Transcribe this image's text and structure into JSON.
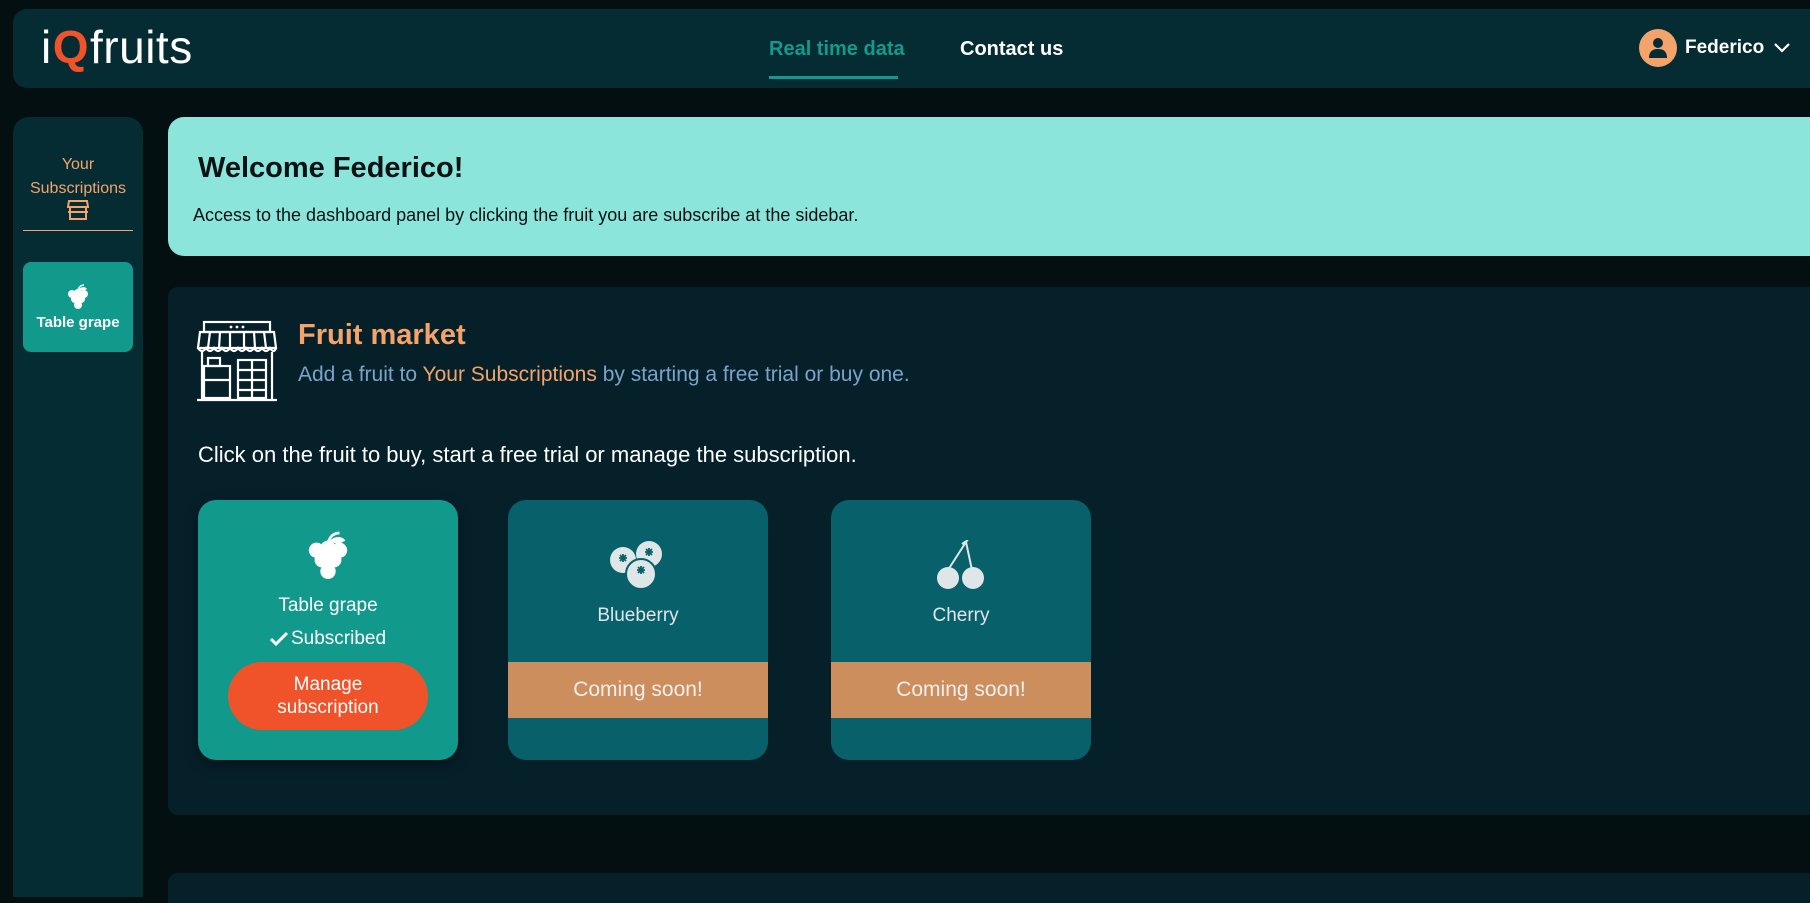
{
  "brand": {
    "logo_prefix": "i",
    "logo_q": "Q",
    "logo_suffix": "fruits"
  },
  "nav": {
    "items": [
      {
        "label": "Real time data",
        "active": true
      },
      {
        "label": "Contact us",
        "active": false
      }
    ]
  },
  "user": {
    "name": "Federico"
  },
  "sidebar": {
    "title": "Your Subscriptions",
    "items": [
      {
        "label": "Table grape",
        "icon": "grape-icon"
      }
    ]
  },
  "welcome": {
    "title": "Welcome Federico!",
    "text": "Access to the dashboard panel by clicking the fruit you are subscribe at the sidebar."
  },
  "market": {
    "title": "Fruit market",
    "subtitle_before": "Add a fruit to ",
    "subtitle_highlight": "Your Subscriptions",
    "subtitle_after": " by starting a free trial or buy one.",
    "instruction": "Click on the fruit to buy, start a free trial or manage the subscription.",
    "cards": [
      {
        "name": "Table grape",
        "status": "Subscribed",
        "button": "Manage subscription",
        "icon": "grape-icon"
      },
      {
        "name": "Blueberry",
        "status": "Coming soon!",
        "icon": "blueberry-icon"
      },
      {
        "name": "Cherry",
        "status": "Coming soon!",
        "icon": "cherry-icon"
      }
    ]
  },
  "colors": {
    "accent_teal": "#119a8c",
    "accent_orange": "#f4a46b",
    "button_red": "#f0532a",
    "welcome_bg": "#8ce5db",
    "soon_band": "#cd8e5e"
  }
}
